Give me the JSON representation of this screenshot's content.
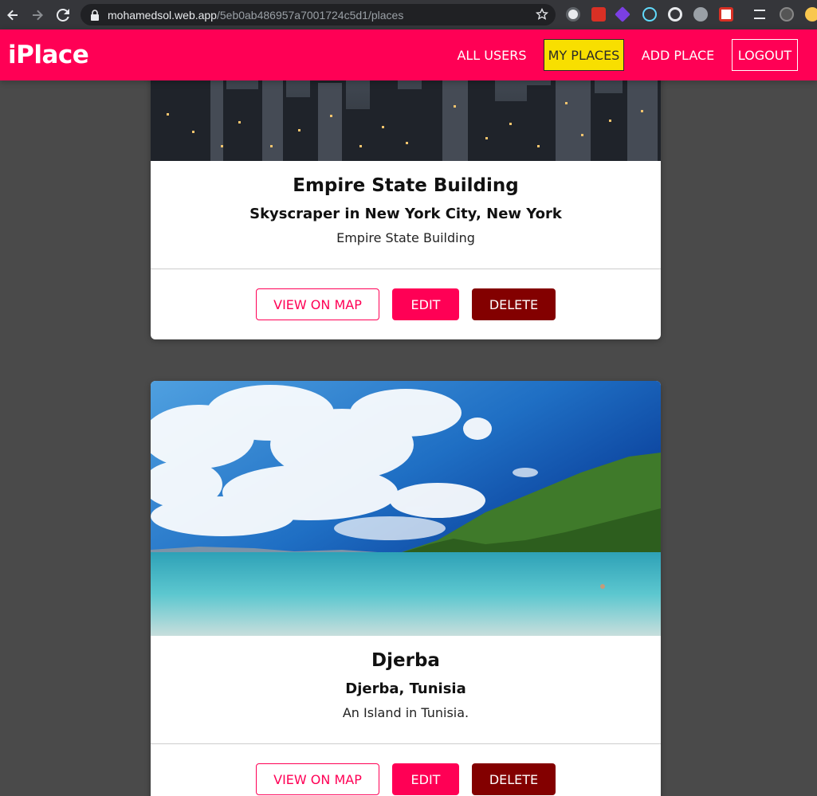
{
  "browser": {
    "url_domain": "mohamedsol.web.app",
    "url_path": "/5eb0ab486957a7001724c5d1/places"
  },
  "header": {
    "logo": "iPlace",
    "nav": {
      "all_users": "ALL USERS",
      "my_places": "MY PLACES",
      "add_place": "ADD PLACE",
      "logout": "LOGOUT"
    }
  },
  "places": [
    {
      "title": "Empire State Building",
      "address": "Skyscraper in New York City, New York",
      "description": "Empire State Building",
      "image": "city-skyline-image"
    },
    {
      "title": "Djerba",
      "address": "Djerba, Tunisia",
      "description": "An Island in Tunisia.",
      "image": "beach-island-image"
    }
  ],
  "actions": {
    "view_on_map": "VIEW ON MAP",
    "edit": "EDIT",
    "delete": "DELETE"
  },
  "colors": {
    "brand": "#ff0055",
    "active_nav": "#f8df00",
    "delete": "#830000",
    "background": "#4a4a4a"
  }
}
